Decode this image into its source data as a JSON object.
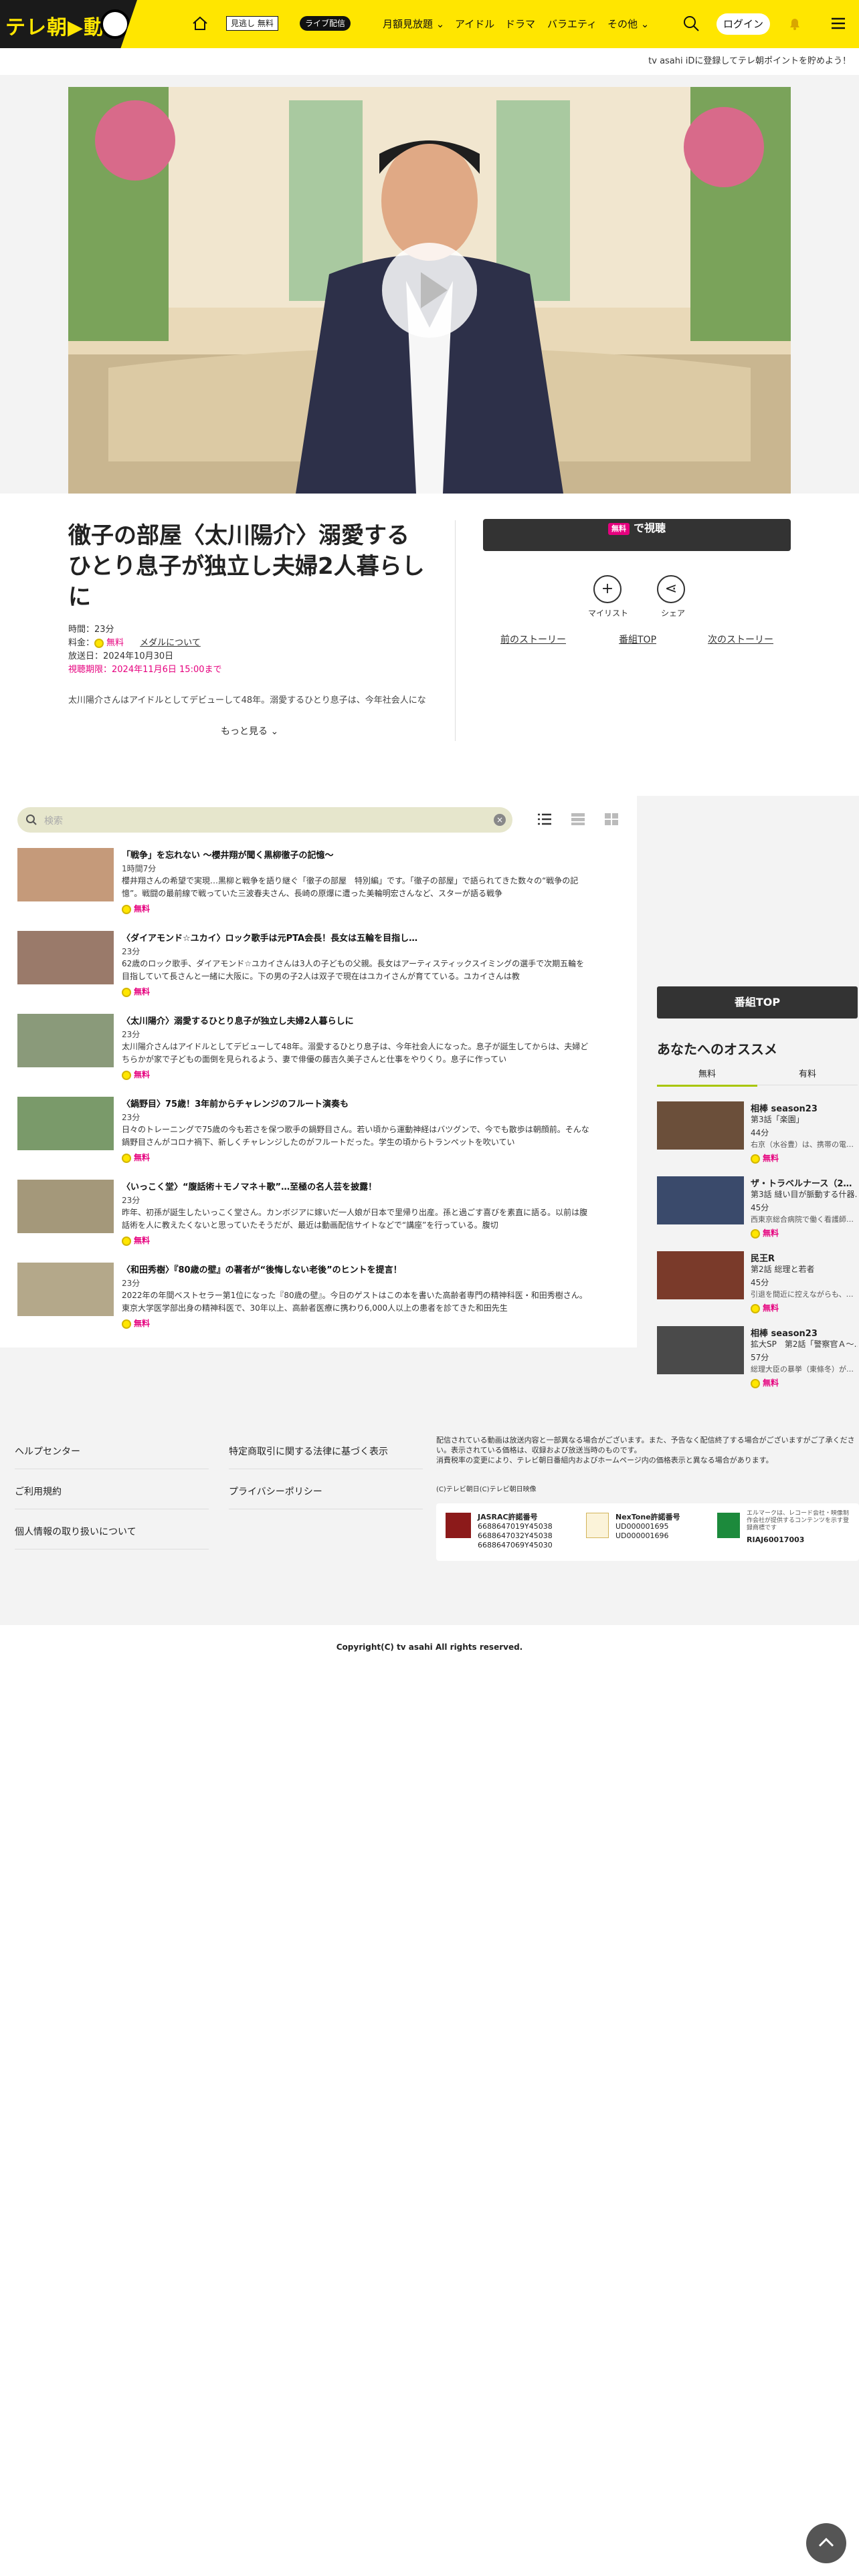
{
  "header": {
    "logo_text": "テレ朝",
    "logo_arrow": "動画",
    "nav_badge": "見逃し 無料",
    "nav_badge2": "ライブ配信",
    "nav_items": [
      "月額見放題",
      "アイドル",
      "ドラマ",
      "バラエティ",
      "その他"
    ],
    "login": "ログイン"
  },
  "subbar": {
    "text": "tv asahi iDに登録してテレ朝ポイントを貯めよう！"
  },
  "episode": {
    "title": "徹子の部屋〈太川陽介〉溺愛するひとり息子が独立し夫婦2人暮らしに",
    "duration": "時間：23分",
    "fee_label": "料金：",
    "fee_value": "無料",
    "media_link": "メダルについて",
    "air_date": "放送日：2024年10月30日",
    "deadline": "視聴期限：2024年11月6日 15:00まで",
    "desc": "太川陽介さんはアイドルとしてデビューして48年。溺愛するひとり息子は、今年社会人にな",
    "more": "もっと見る",
    "watch_prefix": "無料",
    "watch_label": "で視聴",
    "mylist": "マイリスト",
    "share": "シェア",
    "prev": "前のストーリー",
    "top": "番組TOP",
    "next": "次のストーリー"
  },
  "list": {
    "search_placeholder": "検索",
    "items": [
      {
        "title": "「戦争」を忘れない ～櫻井翔が聞く黒柳徹子の記憶～",
        "dur": "1時間7分",
        "desc": "櫻井翔さんの希望で実現…黒柳と戦争を語り継ぐ「徹子の部屋　特別編」です。「徹子の部屋」で語られてきた数々の“戦争の記憶”。戦闘の最前線で戦っていた三波春夫さん、長崎の原爆に遭った美輪明宏さんなど、スターが語る戦争",
        "free": "無料"
      },
      {
        "title": "〈ダイアモンド☆ユカイ〉ロック歌手は元PTA会長！長女は五輪を目指し…",
        "dur": "23分",
        "desc": "62歳のロック歌手、ダイアモンド☆ユカイさんは3人の子どもの父親。長女はアーティスティックスイミングの選手で次期五輪を目指していて長さんと一緒に大阪に。下の男の子2人は双子で現在はユカイさんが育てている。ユカイさんは教",
        "free": "無料"
      },
      {
        "title": "〈太川陽介〉溺愛するひとり息子が独立し夫婦2人暮らしに",
        "dur": "23分",
        "desc": "太川陽介さんはアイドルとしてデビューして48年。溺愛するひとり息子は、今年社会人になった。息子が誕生してからは、夫婦どちらかが家で子どもの面倒を見られるよう、妻で俳優の藤吉久美子さんと仕事をやりくり。息子に作ってい",
        "free": "無料"
      },
      {
        "title": "〈鍋野目〉75歳！3年前からチャレンジのフルート演奏も",
        "dur": "23分",
        "desc": "日々のトレーニングで75歳の今も若さを保つ歌手の鍋野目さん。若い頃から運動神経はバツグンで、今でも散歩は朝顔前。そんな鍋野目さんがコロナ禍下、新しくチャレンジしたのがフルートだった。学生の頃からトランペットを吹いてい",
        "free": "無料"
      },
      {
        "title": "〈いっこく堂〉“腹話術＋モノマネ＋歌”…至極の名人芸を披露！",
        "dur": "23分",
        "desc": "昨年、初孫が誕生したいっこく堂さん。カンボジアに嫁いだ一人娘が日本で里帰り出産。孫と過ごす喜びを素直に語る。以前は腹話術を人に教えたくないと思っていたそうだが、最近は動画配信サイトなどで“講座”を行っている。腹切",
        "free": "無料"
      },
      {
        "title": "〈和田秀樹〉『80歳の壁』の著者が“後悔しない老後”のヒントを提言！",
        "dur": "23分",
        "desc": "2022年の年間ベストセラー第1位になった『80歳の壁』。今日のゲストはこの本を書いた高齢者専門の精神科医・和田秀樹さん。東京大学医学部出身の精神科医で、30年以上、高齢者医療に携わり6,000人以上の患者を診てきた和田先生",
        "free": "無料"
      }
    ]
  },
  "side": {
    "top_button": "番組TOP",
    "rec_heading": "あなたへのオススメ",
    "tab_free": "無料",
    "tab_paid": "有料",
    "items": [
      {
        "title": "相棒 season23",
        "sub": "第3話「楽園」",
        "dur": "44分",
        "desc": "右京（水谷豊）は、携帯の電…",
        "free": "無料"
      },
      {
        "title": "ザ・トラベルナース（2…",
        "sub": "第3話 縫い目が脈動する什器…",
        "dur": "45分",
        "desc": "西東京総合病院で働く看護師…",
        "free": "無料"
      },
      {
        "title": "民王R",
        "sub": "第2話 総理と若者",
        "dur": "45分",
        "desc": "引退を間近に控えながらも、…",
        "free": "無料"
      },
      {
        "title": "相棒 season23",
        "sub": "拡大SP　第2話「警察官Ａ～…",
        "dur": "57分",
        "desc": "総理大臣の暴挙（東條冬）が…",
        "free": "無料"
      }
    ]
  },
  "footer": {
    "links_left": [
      "ヘルプセンター",
      "ご利用規約",
      "個人情報の取り扱いについて"
    ],
    "links_right": [
      "特定商取引に関する法律に基づく表示",
      "プライバシーポリシー"
    ],
    "notice": "配信されている動画は放送内容と一部異なる場合がございます。また、予告なく配信終了する場合がございますがご了承ください。表示されている価格は、収録および放送当時のものです。",
    "notice2": "消費税率の変更により、テレビ朝日番組内およびホームページ内の価格表示と異なる場合があります。",
    "copyright_small": "(C)テレビ朝日(C)テレビ朝日映像",
    "jasrac_label": "JASRAC許諾番号",
    "jasrac_nums": [
      "6688647019Y45038",
      "6688647032Y45038",
      "6688647069Y45030"
    ],
    "nextone_label": "NexTone許諾番号",
    "nextone_nums": [
      "UD000001695",
      "UD000001696"
    ],
    "lmark_text": "エルマークは、レコード会社・映像制作会社が提供するコンテンツを示す登録商標です",
    "lmark_code": "RIAJ60017003",
    "copyright": "Copyright(C) tv asahi All rights reserved."
  }
}
